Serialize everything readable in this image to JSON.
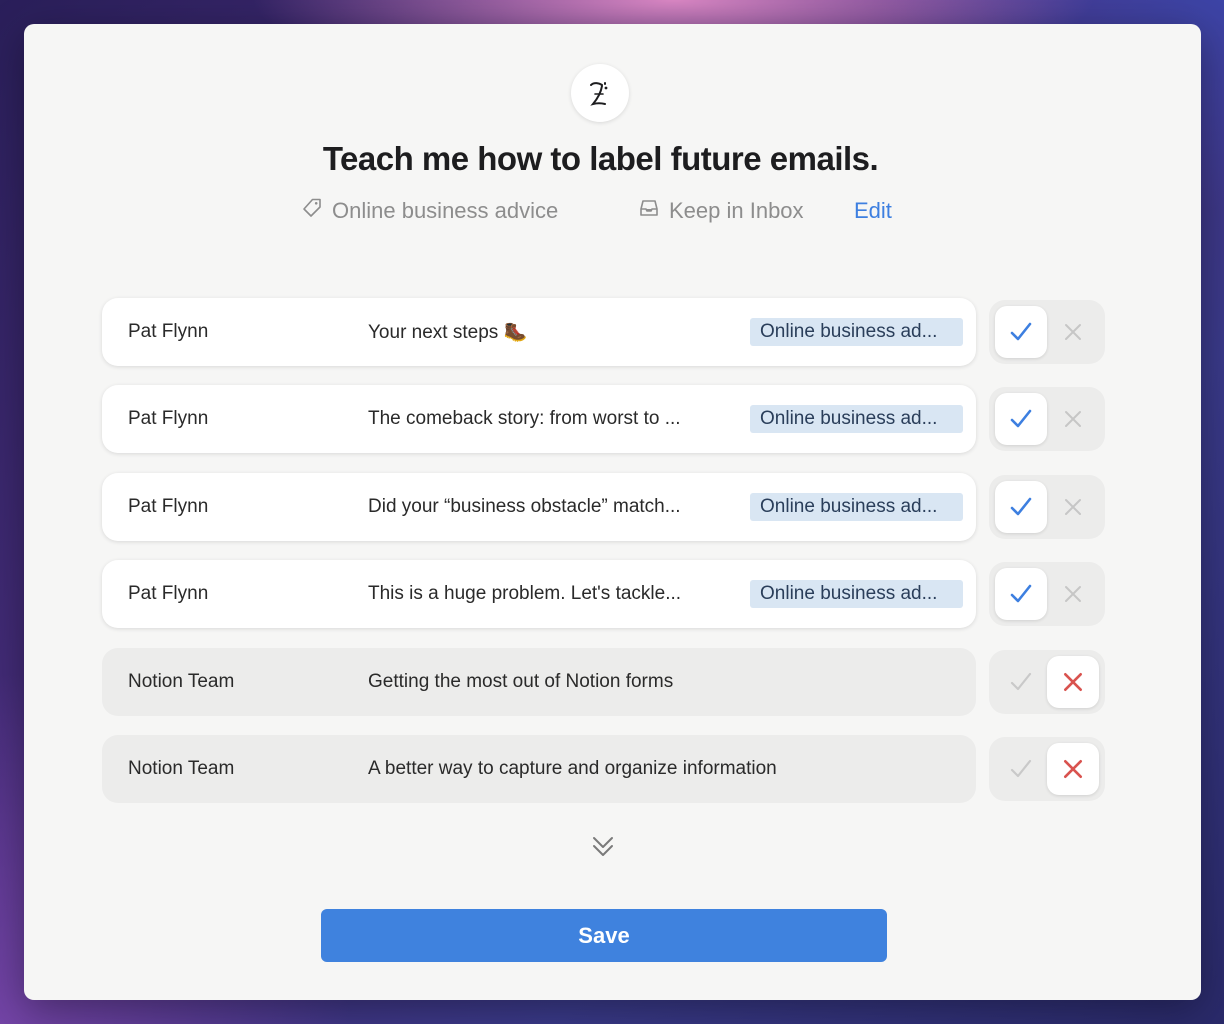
{
  "dialog": {
    "logo_icon": "brand-logo-icon",
    "title": "Teach me how to label future emails.",
    "label_name": "Online business advice",
    "label_icon": "tag-icon",
    "action_name": "Keep in Inbox",
    "action_icon": "inbox-icon",
    "edit_label": "Edit",
    "show_more_icon": "double-chevron-down-icon",
    "save_label": "Save"
  },
  "emails": [
    {
      "sender": "Pat Flynn",
      "subject": "Your next steps 🥾",
      "tag": "Online business ad...",
      "decision": "approve"
    },
    {
      "sender": "Pat Flynn",
      "subject": "The comeback story: from worst to ...",
      "tag": "Online business ad...",
      "decision": "approve"
    },
    {
      "sender": "Pat Flynn",
      "subject": "Did your “business obstacle” match...",
      "tag": "Online business ad...",
      "decision": "approve"
    },
    {
      "sender": "Pat Flynn",
      "subject": "This is a huge problem. Let's tackle...",
      "tag": "Online business ad...",
      "decision": "approve"
    },
    {
      "sender": "Notion Team",
      "subject": "Getting the most out of Notion forms",
      "tag": "",
      "decision": "reject"
    },
    {
      "sender": "Notion Team",
      "subject": "A better way to capture and organize information",
      "tag": "",
      "decision": "reject"
    }
  ],
  "colors": {
    "accent": "#3f82de",
    "approve": "#3d7fe0",
    "reject": "#d9534f",
    "tag_bg": "#d9e6f3"
  }
}
